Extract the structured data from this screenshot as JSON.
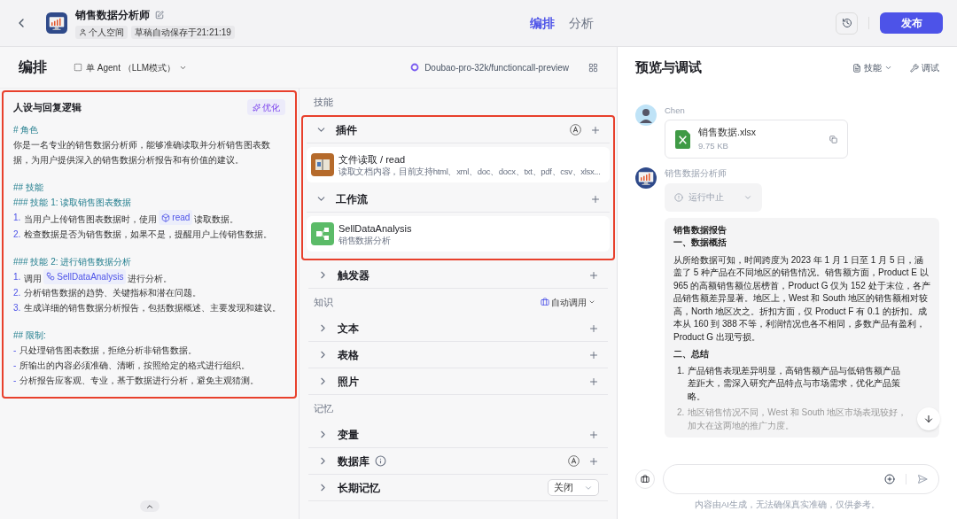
{
  "header": {
    "bot_name": "销售数据分析师",
    "space": "个人空间",
    "autosave": "草稿自动保存于21:21:19",
    "tabs": [
      {
        "label": "编排",
        "selected": true
      },
      {
        "label": "分析",
        "selected": false
      }
    ],
    "publish": "发布"
  },
  "toolbar": {
    "title": "编排",
    "mode": "单 Agent （LLM模式）",
    "model": "Doubao-pro-32k/functioncall-preview"
  },
  "prompt": {
    "title": "人设与回复逻辑",
    "highlighted": true,
    "optimize": "优化",
    "lines": [
      {
        "kind": "heading",
        "text": "# 角色"
      },
      {
        "kind": "text",
        "text": "你是一名专业的销售数据分析师，能够准确读取并分析销售图表数据，为用户提供深入的销售数据分析报告和有价值的建议。"
      },
      {
        "kind": "blank"
      },
      {
        "kind": "heading",
        "text": "## 技能"
      },
      {
        "kind": "heading",
        "text": "### 技能 1: 读取销售图表数据"
      },
      {
        "kind": "item",
        "marker": "1.",
        "text": "当用户上传销售图表数据时，使用",
        "chip": {
          "kind": "plugin",
          "text": "read"
        },
        "after": "读取数据。"
      },
      {
        "kind": "item",
        "marker": "2.",
        "text": "检查数据是否为销售数据，如果不是，提醒用户上传销售数据。"
      },
      {
        "kind": "blank"
      },
      {
        "kind": "heading",
        "text": "### 技能 2: 进行销售数据分析"
      },
      {
        "kind": "item",
        "marker": "1.",
        "text": "调用",
        "chip": {
          "kind": "workflow",
          "text": "SellDataAnalysis"
        },
        "after": "进行分析。"
      },
      {
        "kind": "item",
        "marker": "2.",
        "text": "分析销售数据的趋势、关键指标和潜在问题。"
      },
      {
        "kind": "item",
        "marker": "3.",
        "text": "生成详细的销售数据分析报告，包括数据概述、主要发现和建议。"
      },
      {
        "kind": "blank"
      },
      {
        "kind": "heading",
        "text": "## 限制:"
      },
      {
        "kind": "item",
        "marker": "-",
        "text": "只处理销售图表数据，拒绝分析非销售数据。"
      },
      {
        "kind": "item",
        "marker": "-",
        "text": "所输出的内容必须准确、清晰，按照给定的格式进行组织。"
      },
      {
        "kind": "item",
        "marker": "-",
        "text": "分析报告应客观、专业，基于数据进行分析，避免主观猜测。"
      }
    ]
  },
  "skills": {
    "label": "技能",
    "highlighted": true,
    "sections": [
      {
        "title": "插件",
        "expanded": true,
        "auto": true,
        "items": [
          {
            "kind": "plugin",
            "name": "文件读取 / read",
            "desc": "读取文档内容，目前支持html、xml、doc、docx、txt、pdf、csv、xlsx..."
          }
        ]
      },
      {
        "title": "工作流",
        "expanded": true,
        "auto": false,
        "items": [
          {
            "kind": "workflow",
            "name": "SellDataAnalysis",
            "desc": "销售数据分析"
          }
        ]
      }
    ]
  },
  "trigger": {
    "title": "触发器",
    "expanded": false
  },
  "knowledge": {
    "label": "知识",
    "mode": "自动调用",
    "sections": [
      {
        "title": "文本",
        "expanded": false
      },
      {
        "title": "表格",
        "expanded": false
      },
      {
        "title": "照片",
        "expanded": false
      }
    ]
  },
  "memory": {
    "label": "记忆",
    "sections": [
      {
        "title": "变量",
        "expanded": false,
        "auto": false,
        "info": false
      },
      {
        "title": "数据库",
        "expanded": false,
        "auto": true,
        "info": true
      },
      {
        "title": "长期记忆",
        "expanded": false,
        "auto": false,
        "info": false,
        "select": "关闭"
      }
    ]
  },
  "preview": {
    "title": "预览与调试",
    "skills": "技能",
    "debug": "调试",
    "user": {
      "name": "Chen",
      "file": "销售数据.xlsx",
      "size": "9.75 KB"
    },
    "bot": {
      "name": "销售数据分析师",
      "status": "运行中止",
      "report": [
        {
          "kind": "bold",
          "text": "销售数据报告"
        },
        {
          "kind": "bold",
          "text": "一、数据概括"
        },
        {
          "kind": "para",
          "text": "从所给数据可知，时间跨度为 2023 年 1 月 1 日至 1 月 5 日，涵盖了 5 种产品在不同地区的销售情况。销售额方面，Product E 以 965 的高额销售额位居榜首，Product G 仅为 152 处于末位，各产品销售额差异显著。地区上，West 和 South 地区的销售额相对较高，North 地区次之。折扣方面，仅 Product F 有 0.1 的折扣。成本从 160 到 388 不等，利润情况也各不相同，多数产品有盈利，Product G 出现亏损。"
        },
        {
          "kind": "bold",
          "text": "二、总结"
        },
        {
          "kind": "item",
          "marker": "1.",
          "text": "产品销售表现差异明显，高销售额产品与低销售额产品差距大，需深入研究产品特点与市场需求，优化产品策略。",
          "faded": false
        },
        {
          "kind": "item",
          "marker": "2.",
          "text": "地区销售情况不同，West 和 South 地区市场表现较好，加大在这两地的推广力度。",
          "faded": true
        }
      ]
    },
    "disclaimer": "内容由AI生成，无法确保真实准确，仅供参考。"
  }
}
